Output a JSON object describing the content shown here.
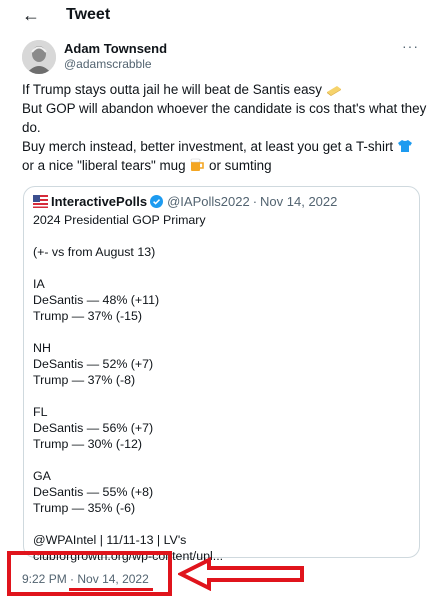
{
  "header": {
    "back_glyph": "←",
    "title": "Tweet"
  },
  "author": {
    "name": "Adam Townsend",
    "handle": "@adamscrabble",
    "more_glyph": "···"
  },
  "tweet": {
    "lines": [
      "If Trump stays outta jail he will beat de Santis easy",
      "But GOP will abandon whoever the candidate is cos that's what they do.",
      "Buy merch instead, better investment, at least you get a T-shirt",
      "or a nice \"liberal tears\" mug",
      "or sumting"
    ]
  },
  "quote": {
    "name": "InteractivePolls",
    "handle": "@IAPolls2022",
    "separator": "·",
    "date": "Nov 14, 2022",
    "body_lines": [
      "2024 Presidential GOP Primary",
      "",
      "(+- vs  from August 13)",
      "",
      "IA",
      "DeSantis — 48% (+11)",
      "Trump — 37% (-15)",
      "",
      "NH",
      "DeSantis — 52% (+7)",
      "Trump — 37% (-8)",
      "",
      "FL",
      "DeSantis — 56% (+7)",
      "Trump — 30% (-12)",
      "",
      "GA",
      "DeSantis — 55% (+8)",
      "Trump — 35% (-6)",
      "",
      "@WPAIntel | 11/11-13 | LV's",
      "clubforgrowth.org/wp-content/upl..."
    ]
  },
  "timestamp": {
    "time": "9:22 PM",
    "separator": "·",
    "date": "Nov 14, 2022"
  },
  "colors": {
    "annotation": "#e0141c",
    "verified": "#1d9bf0",
    "secondary_text": "#536471"
  }
}
